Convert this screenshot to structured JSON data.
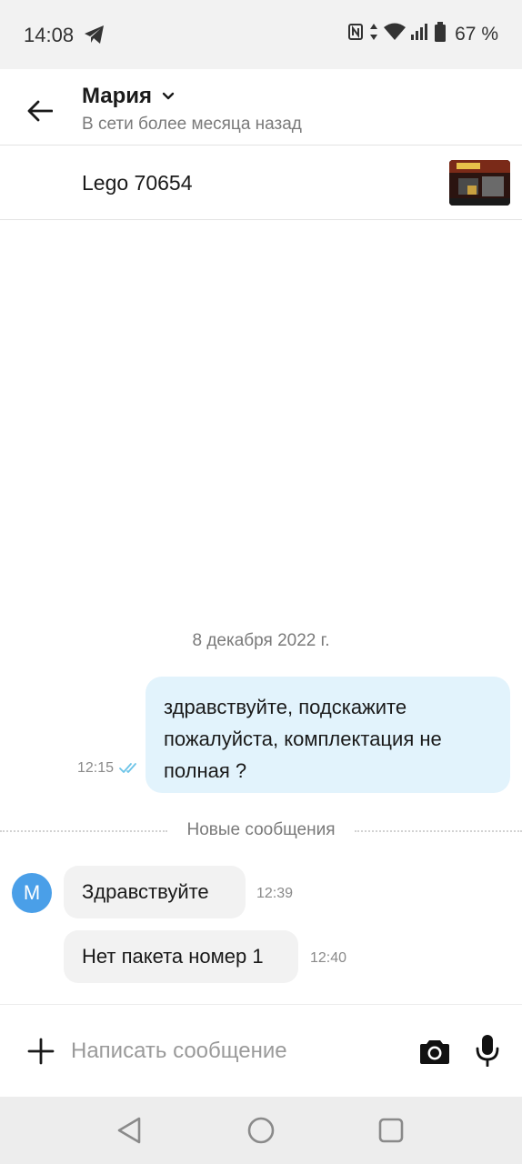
{
  "status_bar": {
    "time": "14:08",
    "battery": "67 %",
    "icons": [
      "telegram-icon",
      "nfc-icon",
      "data-arrows-icon",
      "wifi-icon",
      "signal-icon",
      "battery-icon"
    ]
  },
  "header": {
    "name": "Мария",
    "status": "В сети более месяца назад"
  },
  "product": {
    "title": "Lego 70654"
  },
  "chat": {
    "date": "8 декабря 2022 г.",
    "outgoing": [
      {
        "lines": [
          "здравствуйте, подскажите",
          "пожалуйста, комплектация не",
          "полная ?"
        ],
        "time": "12:15"
      }
    ],
    "new_messages_label": "Новые сообщения",
    "avatar_letter": "М",
    "incoming": [
      {
        "text": "Здравствуйте",
        "time": "12:39"
      },
      {
        "text": "Нет пакета номер 1",
        "time": "12:40"
      }
    ]
  },
  "input": {
    "placeholder": "Написать сообщение"
  },
  "colors": {
    "accent": "#4a9fe8",
    "outgoing_bubble": "#e2f3fc",
    "incoming_bubble": "#f2f2f2",
    "read_check": "#6cc4e8"
  }
}
